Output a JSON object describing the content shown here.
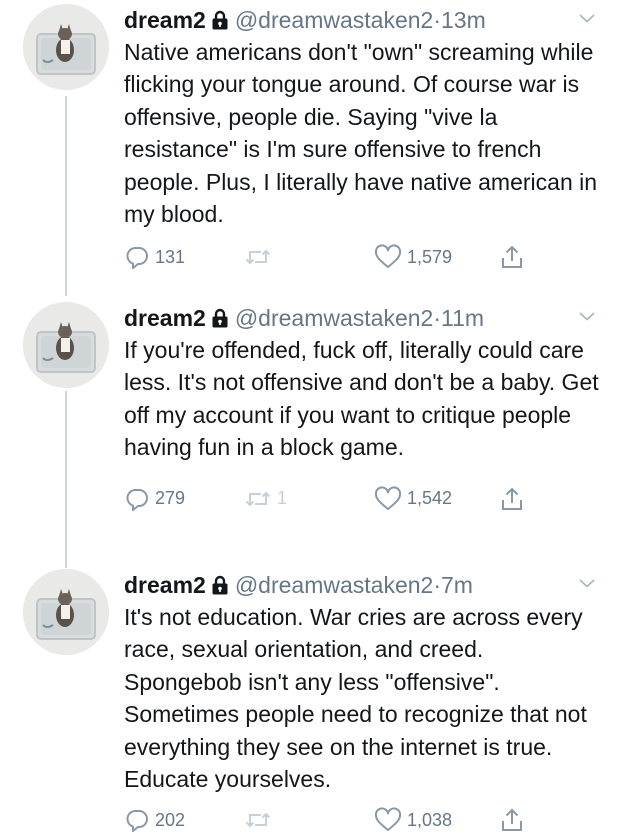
{
  "tweets": [
    {
      "display_name": "dream2",
      "handle": "@dreamwastaken2",
      "separator": "·",
      "time": "13m",
      "text": "Native americans don't \"own\" screaming while flicking your tongue around. Of course war is offensive, people die. Saying \"vive la resistance\" is I'm sure offensive to french people. Plus, I literally have native american in my blood.",
      "reply_count": "131",
      "retweet_count": "",
      "like_count": "1,579"
    },
    {
      "display_name": "dream2",
      "handle": "@dreamwastaken2",
      "separator": "·",
      "time": "11m",
      "text": "If you're offended, fuck off, literally could care less. It's not offensive and don't be a baby. Get off my account if you want to critique people having fun in a block game.",
      "reply_count": "279",
      "retweet_count": "1",
      "like_count": "1,542"
    },
    {
      "display_name": "dream2",
      "handle": "@dreamwastaken2",
      "separator": "·",
      "time": "7m",
      "text": "It's not education. War cries are across every race, sexual orientation, and creed. Spongebob isn't any less \"offensive\". Sometimes people need to recognize that not everything they see on the internet is true. Educate yourselves.",
      "reply_count": "202",
      "retweet_count": "",
      "like_count": "1,038"
    }
  ],
  "icons": {
    "reply": "reply-icon",
    "retweet": "retweet-icon",
    "like": "heart-icon",
    "share": "share-icon",
    "lock": "lock-icon",
    "chevron": "chevron-down-icon"
  },
  "colors": {
    "text": "#14171a",
    "secondary": "#657786",
    "icon": "#8899a6",
    "thread_line": "#ccd6dd"
  }
}
